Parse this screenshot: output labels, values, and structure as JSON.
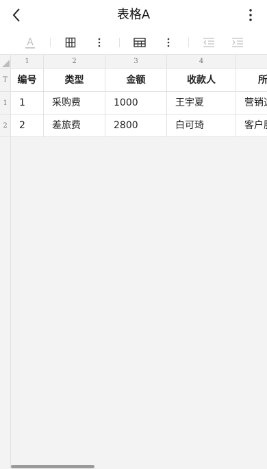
{
  "header": {
    "title": "表格A",
    "back_icon": "chevron-left-icon",
    "more_icon": "more-vertical-icon"
  },
  "toolbar": {
    "buttons": [
      {
        "name": "font-color-icon"
      },
      {
        "name": "column-layout-icon"
      },
      {
        "name": "more-vertical-icon"
      },
      {
        "name": "table-grid-icon"
      },
      {
        "name": "more-vertical-icon"
      },
      {
        "name": "outdent-icon"
      },
      {
        "name": "indent-icon"
      }
    ]
  },
  "sheet": {
    "row_header_title": "T",
    "column_numbers": [
      "1",
      "2",
      "3",
      "4"
    ],
    "row_numbers": [
      "1",
      "2"
    ],
    "headers": [
      "编号",
      "类型",
      "金额",
      "收款人",
      "所"
    ],
    "rows": [
      [
        "1",
        "采购费",
        "1000",
        "王宇夏",
        "营销这"
      ],
      [
        "2",
        "差旅费",
        "2800",
        "白可琦",
        "客户服"
      ]
    ]
  },
  "colors": {
    "grid_line": "#e2e2e2",
    "header_bg": "#f3f3f3",
    "scrollbar": "#9a9a9a"
  }
}
